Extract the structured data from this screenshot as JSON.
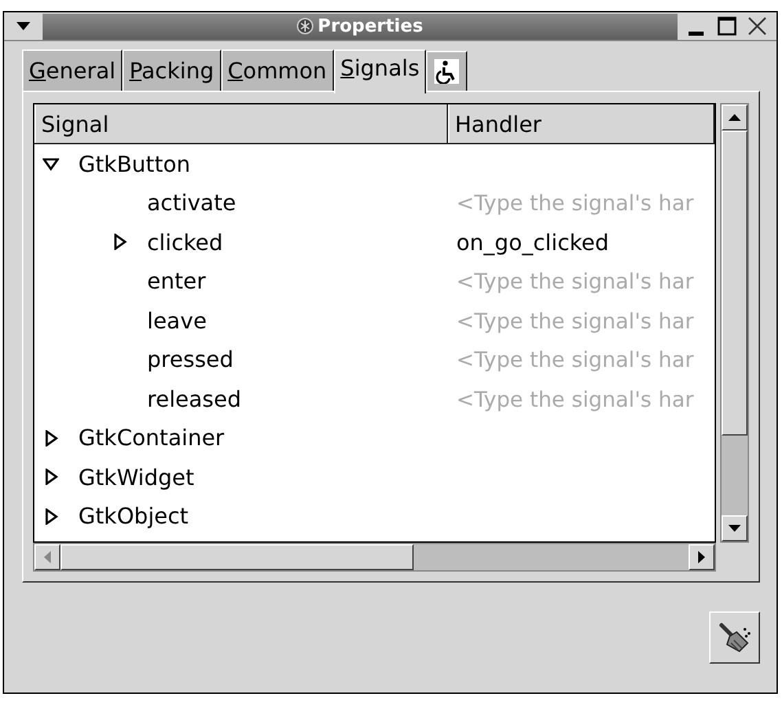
{
  "window": {
    "title": "Properties"
  },
  "tabs": [
    {
      "label": "General",
      "selected": false
    },
    {
      "label": "Packing",
      "selected": false
    },
    {
      "label": "Common",
      "selected": false
    },
    {
      "label": "Signals",
      "selected": true
    },
    {
      "kind": "icon",
      "selected": false
    }
  ],
  "table": {
    "columns": [
      "Signal",
      "Handler"
    ],
    "rows": [
      {
        "name": "GtkButton",
        "expanded": true,
        "children": [
          {
            "name": "activate",
            "handler": "<Type the signal's har",
            "hint": true
          },
          {
            "name": "clicked",
            "expanded": false,
            "handler": "on_go_clicked",
            "hint": false
          },
          {
            "name": "enter",
            "handler": "<Type the signal's har",
            "hint": true
          },
          {
            "name": "leave",
            "handler": "<Type the signal's har",
            "hint": true
          },
          {
            "name": "pressed",
            "handler": "<Type the signal's har",
            "hint": true
          },
          {
            "name": "released",
            "handler": "<Type the signal's har",
            "hint": true
          }
        ]
      },
      {
        "name": "GtkContainer",
        "expanded": false
      },
      {
        "name": "GtkWidget",
        "expanded": false
      },
      {
        "name": "GtkObject",
        "expanded": false
      }
    ]
  }
}
